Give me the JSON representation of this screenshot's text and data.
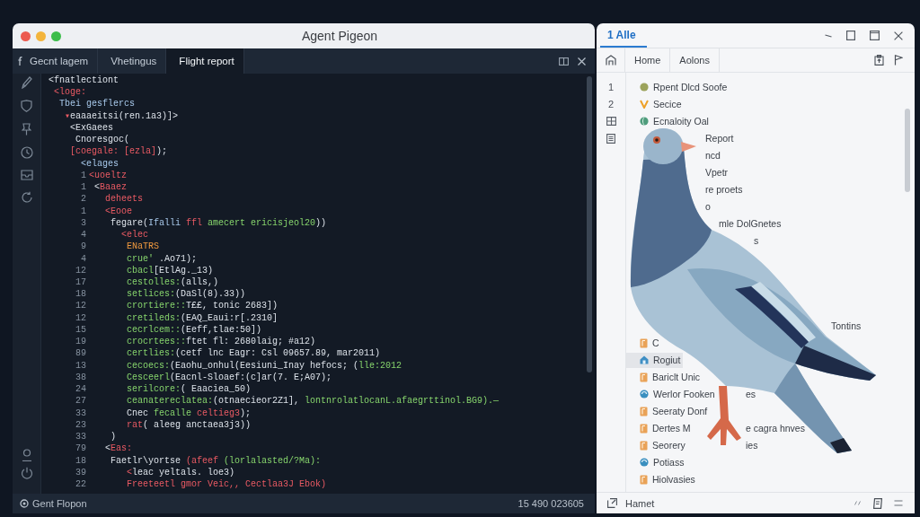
{
  "editor": {
    "title": "Agent Pigeon",
    "tabs": [
      {
        "label": "Gecnt lagem",
        "selected": false
      },
      {
        "label": "Vhetingus",
        "selected": false
      },
      {
        "label": "Flight report",
        "selected": true
      }
    ],
    "code_lines": [
      {
        "segments": [
          {
            "text": "<fnatlectiont",
            "kind": "plain"
          }
        ]
      },
      {
        "segments": [
          {
            "text": " <loge:",
            "kind": "tag"
          }
        ]
      },
      {
        "segments": [
          {
            "text": "  Tbei gesflercs",
            "kind": "attr"
          }
        ]
      },
      {
        "segments": [
          {
            "text": "   ▾",
            "kind": "tag"
          },
          {
            "text": "eaaaeitsi(ren.1a3)]>",
            "kind": "plain"
          }
        ]
      },
      {
        "segments": [
          {
            "text": "    <ExGaees",
            "kind": "plain"
          }
        ]
      },
      {
        "segments": [
          {
            "text": "     Cnoresgoc(",
            "kind": "plain"
          }
        ]
      },
      {
        "segments": [
          {
            "text": "    [coegale: [ezla]",
            "kind": "tag"
          },
          {
            "text": ");",
            "kind": "plain"
          }
        ]
      },
      {
        "segments": [
          {
            "text": "      <elages",
            "kind": "attr"
          }
        ]
      },
      {
        "number": "1",
        "segments": [
          {
            "text": "<uoeltz",
            "kind": "tag"
          }
        ]
      },
      {
        "number": "1",
        "segments": [
          {
            "text": " <",
            "kind": "plain"
          },
          {
            "text": "Baaez",
            "kind": "tag"
          }
        ]
      },
      {
        "number": "2",
        "segments": [
          {
            "text": "   deheets",
            "kind": "tag"
          }
        ]
      },
      {
        "number": "1",
        "segments": [
          {
            "text": "   <Eooe",
            "kind": "tag"
          }
        ]
      },
      {
        "number": "3",
        "segments": [
          {
            "text": "    fegare(",
            "kind": "plain"
          },
          {
            "text": "Ifalli ",
            "kind": "attr"
          },
          {
            "text": "ffl ",
            "kind": "tag"
          },
          {
            "text": "amecert ericisjeol20",
            "kind": "string"
          },
          {
            "text": "))",
            "kind": "plain"
          }
        ]
      },
      {
        "number": "4",
        "segments": [
          {
            "text": "      <elec",
            "kind": "tag"
          }
        ]
      },
      {
        "number": "9",
        "segments": [
          {
            "text": "       ENaTRS",
            "kind": "number"
          }
        ]
      },
      {
        "number": "4",
        "segments": [
          {
            "text": "       crue'",
            "kind": "string"
          },
          {
            "text": " .Ao71);",
            "kind": "plain"
          }
        ]
      },
      {
        "number": "12",
        "segments": [
          {
            "text": "       cbacl",
            "kind": "string"
          },
          {
            "text": "[EtlAg._13)",
            "kind": "plain"
          }
        ]
      },
      {
        "number": "17",
        "segments": [
          {
            "text": "       cestolles:",
            "kind": "string"
          },
          {
            "text": "(alls,)",
            "kind": "plain"
          }
        ]
      },
      {
        "number": "18",
        "segments": [
          {
            "text": "       setlices:",
            "kind": "string"
          },
          {
            "text": "(DaSl(8).33))",
            "kind": "plain"
          }
        ]
      },
      {
        "number": "12",
        "segments": [
          {
            "text": "       crortiere::",
            "kind": "string"
          },
          {
            "text": "T££, tonic 2683])",
            "kind": "plain"
          }
        ]
      },
      {
        "number": "12",
        "segments": [
          {
            "text": "       cretileds:",
            "kind": "string"
          },
          {
            "text": "(EAQ_Eaui:r[.2310]",
            "kind": "plain"
          }
        ]
      },
      {
        "number": "15",
        "segments": [
          {
            "text": "       cecrlcem::",
            "kind": "string"
          },
          {
            "text": "(Eeff,tlae:50])",
            "kind": "plain"
          }
        ]
      },
      {
        "number": "19",
        "segments": [
          {
            "text": "       crocrtees::",
            "kind": "string"
          },
          {
            "text": "ftet fl: 2680laig; #a12)",
            "kind": "plain"
          }
        ]
      },
      {
        "number": "89",
        "segments": [
          {
            "text": "       certlies:",
            "kind": "string"
          },
          {
            "text": "(cetf lnc Eagr: Csl 09657.89, mar2011)",
            "kind": "plain"
          }
        ]
      },
      {
        "number": "13",
        "segments": [
          {
            "text": "       cecoecs:",
            "kind": "string"
          },
          {
            "text": "(Eaohu_onhul(Eesiuni_Inay hefocs; (",
            "kind": "plain"
          },
          {
            "text": "lle:2012",
            "kind": "string"
          }
        ]
      },
      {
        "number": "38",
        "segments": [
          {
            "text": "       Cesceerl",
            "kind": "string"
          },
          {
            "text": "(Eacnl-Sloaef:(c]ar(7. E;A07);",
            "kind": "plain"
          }
        ]
      },
      {
        "number": "24",
        "segments": [
          {
            "text": "       serilcore:",
            "kind": "string"
          },
          {
            "text": "( Eaaciea_50)",
            "kind": "plain"
          }
        ]
      },
      {
        "number": "27",
        "segments": [
          {
            "text": "       ceanatereclatea:",
            "kind": "string"
          },
          {
            "text": "(otnaecieor2Z1], ",
            "kind": "plain"
          },
          {
            "text": "lontnrolatlocanL.afaegrttinol.BG9).—",
            "kind": "string"
          }
        ]
      },
      {
        "number": "33",
        "segments": [
          {
            "text": "       Cnec ",
            "kind": "plain"
          },
          {
            "text": "fecalle ",
            "kind": "string"
          },
          {
            "text": "celtieg3",
            "kind": "tag"
          },
          {
            "text": ");",
            "kind": "plain"
          }
        ]
      },
      {
        "number": "23",
        "segments": [
          {
            "text": "       rat",
            "kind": "tag"
          },
          {
            "text": "( aleeg anctaea3j3))",
            "kind": "plain"
          }
        ]
      },
      {
        "number": "33",
        "segments": [
          {
            "text": "    )",
            "kind": "plain"
          }
        ]
      },
      {
        "number": "79",
        "segments": [
          {
            "text": "   <",
            "kind": "plain"
          },
          {
            "text": "Eas:",
            "kind": "tag"
          }
        ]
      },
      {
        "number": "18",
        "segments": [
          {
            "text": "    Faetlr\\yortse ",
            "kind": "plain"
          },
          {
            "text": "(afeef ",
            "kind": "tag"
          },
          {
            "text": "(lorlalasted/?Ma):",
            "kind": "string"
          }
        ]
      },
      {
        "number": "39",
        "segments": [
          {
            "text": "       <",
            "kind": "tag"
          },
          {
            "text": "leac yeltals. loe3)",
            "kind": "plain"
          }
        ]
      },
      {
        "number": "22",
        "segments": [
          {
            "text": "       Freeteetl gmor Veic,, Cectlaa3J Ebok)",
            "kind": "tag"
          }
        ]
      }
    ],
    "status_bar": {
      "left": "Gent Flopon",
      "right": "15 490 023605"
    }
  },
  "side_panel": {
    "tabs": [
      {
        "label": "1 Alle",
        "selected": true
      }
    ],
    "toolbar_buttons": [
      "Home",
      "Aolons"
    ],
    "gutter": [
      "1",
      "2"
    ],
    "list_upper": [
      {
        "kind": "dot",
        "color": "#9ca35c",
        "text": "Rpent Dlcd Soofe",
        "selected": false
      },
      {
        "kind": "chevron",
        "color": "#eda128",
        "text": "Secice",
        "selected": false
      },
      {
        "kind": "globe",
        "color": "#4e9c7c",
        "text": "Ecnaloity Oal",
        "selected": false
      },
      {
        "kind": "neck",
        "text": "Report",
        "selected": false
      },
      {
        "kind": "neck",
        "text": "ncd",
        "selected": false
      },
      {
        "kind": "neck",
        "text": "Vpetr",
        "selected": false
      },
      {
        "kind": "neck",
        "text": "re proets",
        "selected": false
      },
      {
        "kind": "neck",
        "text": "o",
        "selected": false
      },
      {
        "kind": "shoulder",
        "text": "mle DolGnetes",
        "selected": false
      },
      {
        "kind": "back",
        "text": "s",
        "selected": false
      }
    ],
    "list_lower": [
      {
        "kind": "wing",
        "text": "Tontins",
        "selected": false
      },
      {
        "kind": "file",
        "color": "#e9a257",
        "text": "C",
        "selected": false
      },
      {
        "kind": "home",
        "color": "#3f8fc4",
        "text": "Rogiut",
        "selected": true
      },
      {
        "kind": "file",
        "color": "#e9a257",
        "text": "Bariclt Unic",
        "selected": false
      },
      {
        "kind": "disc",
        "color": "#3a8fbf",
        "text": "Werlor Fooken",
        "trailing": "es",
        "selected": false
      },
      {
        "kind": "file",
        "color": "#e9a257",
        "text": "Seeraty Donf",
        "selected": false
      },
      {
        "kind": "file",
        "color": "#e9a257",
        "text": "Dertes M",
        "trailing": "e cagra hnves",
        "selected": false
      },
      {
        "kind": "file",
        "color": "#e9a257",
        "text": "Seorery",
        "trailing": "ies",
        "selected": false
      },
      {
        "kind": "disc",
        "color": "#3a8fbf",
        "text": "Potiass",
        "selected": false
      },
      {
        "kind": "file",
        "color": "#e9a257",
        "text": "Hiolvasies",
        "selected": false
      }
    ],
    "footer": "Hamet"
  }
}
